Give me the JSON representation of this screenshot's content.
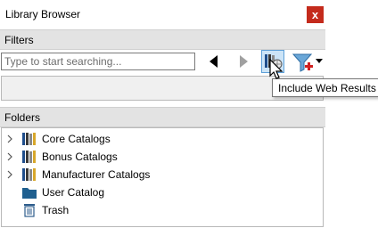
{
  "window": {
    "title": "Library Browser",
    "close_label": "x"
  },
  "filters": {
    "header": "Filters",
    "search_placeholder": "Type to start searching...",
    "tooltip": "Include Web Results"
  },
  "folders": {
    "header": "Folders",
    "items": [
      {
        "label": "Core Catalogs",
        "icon": "catalog-books-icon",
        "expandable": true
      },
      {
        "label": "Bonus Catalogs",
        "icon": "catalog-books-icon",
        "expandable": true
      },
      {
        "label": "Manufacturer Catalogs",
        "icon": "catalog-books-icon",
        "expandable": true
      },
      {
        "label": "User Catalog",
        "icon": "folder-icon",
        "expandable": false
      },
      {
        "label": "Trash",
        "icon": "trash-icon",
        "expandable": false
      }
    ]
  },
  "colors": {
    "close": "#c42b1c",
    "selected_button": "#cce4f7",
    "header_bg": "#e3e3e3",
    "folder": "#1f5f8f"
  }
}
